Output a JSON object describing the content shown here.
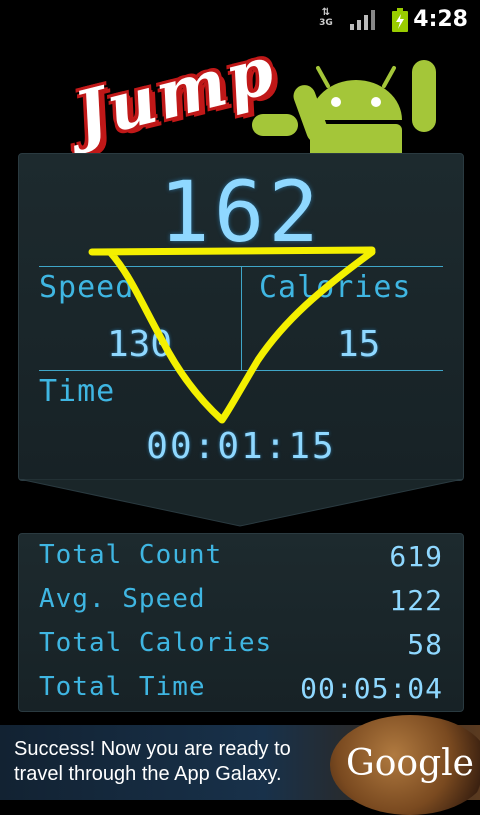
{
  "status_bar": {
    "network": "3G",
    "time": "4:28"
  },
  "header": {
    "title": "Jump"
  },
  "display": {
    "count": "162",
    "speed_label": "Speed",
    "speed_value": "130",
    "calories_label": "Calories",
    "calories_value": "15",
    "time_label": "Time",
    "time_value": "00:01:15"
  },
  "summary": {
    "rows": [
      {
        "label": "Total Count",
        "value": "619"
      },
      {
        "label": "Avg. Speed",
        "value": "122"
      },
      {
        "label": "Total Calories",
        "value": "58"
      },
      {
        "label": "Total Time",
        "value": "00:05:04"
      }
    ]
  },
  "ad": {
    "text": "Success! Now you are ready to travel through the App Galaxy.",
    "brand": "Google"
  },
  "colors": {
    "accent": "#3fb6e2",
    "digits": "#8fd8ff",
    "scribble": "#f4f000",
    "android_green": "#a4c639"
  },
  "icons": [
    "network-3g-icon",
    "signal-strength-icon",
    "battery-charging-icon",
    "android-robot-icon"
  ]
}
